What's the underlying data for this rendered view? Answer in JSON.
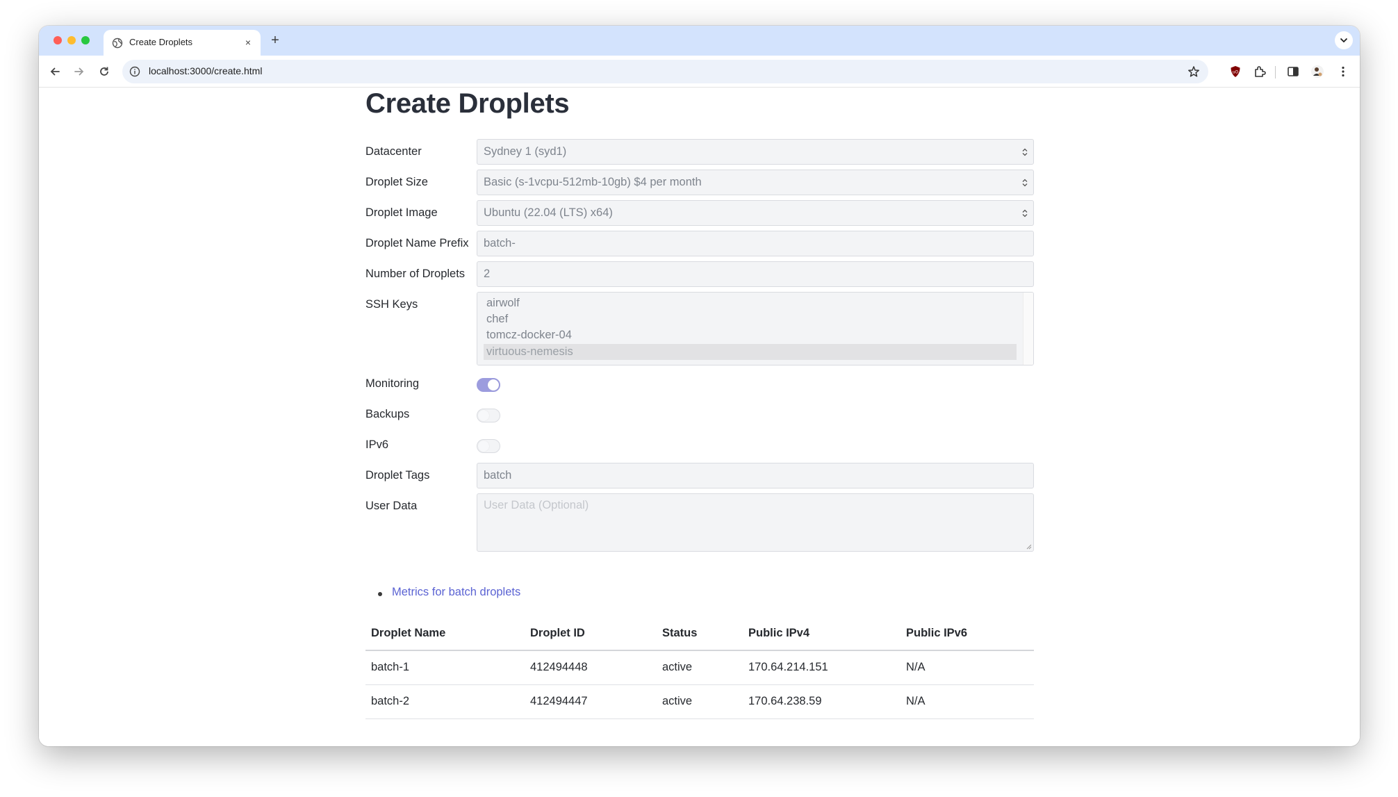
{
  "browser": {
    "tab_title": "Create Droplets",
    "tab_close": "×",
    "new_tab": "+",
    "url": "localhost:3000/create.html"
  },
  "page": {
    "title": "Create Droplets",
    "form": {
      "datacenter": {
        "label": "Datacenter",
        "value": "Sydney 1 (syd1)"
      },
      "size": {
        "label": "Droplet Size",
        "value": "Basic (s-1vcpu-512mb-10gb) $4 per month"
      },
      "image": {
        "label": "Droplet Image",
        "value": "Ubuntu (22.04 (LTS) x64)"
      },
      "name_prefix": {
        "label": "Droplet Name Prefix",
        "value": "batch-"
      },
      "count": {
        "label": "Number of Droplets",
        "value": "2"
      },
      "ssh_keys": {
        "label": "SSH Keys",
        "options": [
          "airwolf",
          "chef",
          "tomcz-docker-04",
          "virtuous-nemesis"
        ],
        "selected": "virtuous-nemesis"
      },
      "monitoring": {
        "label": "Monitoring",
        "on": true
      },
      "backups": {
        "label": "Backups",
        "on": false
      },
      "ipv6": {
        "label": "IPv6",
        "on": false
      },
      "tags": {
        "label": "Droplet Tags",
        "value": "batch"
      },
      "user_data": {
        "label": "User Data",
        "placeholder": "User Data (Optional)"
      }
    },
    "links": [
      "Metrics for batch droplets"
    ],
    "table": {
      "headers": [
        "Droplet Name",
        "Droplet ID",
        "Status",
        "Public IPv4",
        "Public IPv6"
      ],
      "rows": [
        [
          "batch-1",
          "412494448",
          "active",
          "170.64.214.151",
          "N/A"
        ],
        [
          "batch-2",
          "412494447",
          "active",
          "170.64.238.59",
          "N/A"
        ]
      ]
    }
  },
  "colors": {
    "tabstrip": "#d3e3fd",
    "link": "#5b63d3",
    "toggle_on": "#9c9cde",
    "field_bg": "#f3f4f6"
  }
}
